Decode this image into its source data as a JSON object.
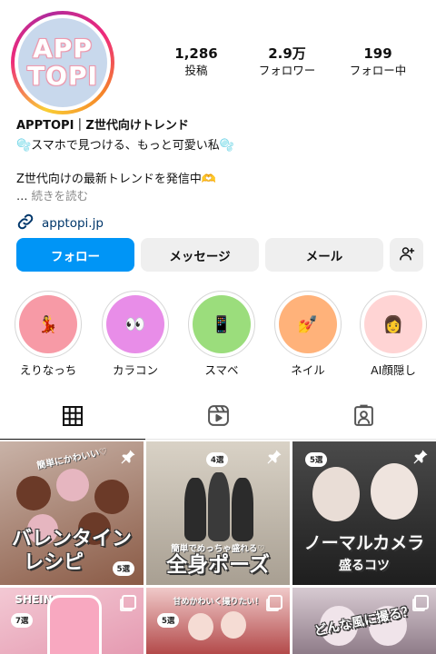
{
  "profile": {
    "avatar_line1": "APP",
    "avatar_line2": "TOPI",
    "name": "APPTOPI｜Z世代向けトレンド",
    "bio_line1": "🫧スマホで見つける、もっと可愛い私🫧",
    "bio_line2": "Z世代向けの最新トレンドを発信中🫶",
    "bio_ellipsis": "…",
    "bio_more": "続きを読む",
    "link": "apptopi.jp"
  },
  "stats": [
    {
      "value": "1,286",
      "label": "投稿"
    },
    {
      "value": "2.9万",
      "label": "フォロワー"
    },
    {
      "value": "199",
      "label": "フォロー中"
    }
  ],
  "buttons": {
    "follow": "フォロー",
    "message": "メッセージ",
    "mail": "メール"
  },
  "highlights": [
    {
      "label": "えりなっち",
      "emoji": "💃",
      "color": "#f79aa6"
    },
    {
      "label": "カラコン",
      "emoji": "👀",
      "color": "#e88de8"
    },
    {
      "label": "スマベ",
      "emoji": "📱",
      "color": "#9bdd7c"
    },
    {
      "label": "ネイル",
      "emoji": "💅",
      "color": "#ffb27a"
    },
    {
      "label": "AI顔隠し",
      "emoji": "👩",
      "color": "#ffd4d4"
    }
  ],
  "posts": [
    {
      "title1": "バレンタイン",
      "title2": "レシピ",
      "top": "簡単にかわいい♡",
      "badge": "5選",
      "colors": [
        "#c9b3a8",
        "#8a5a45"
      ]
    },
    {
      "title1": "全身ポーズ",
      "title2": "",
      "top": "簡単でめっちゃ盛れる♡",
      "badge": "4選",
      "colors": [
        "#d9d2c6",
        "#a89f92"
      ]
    },
    {
      "title1": "ノーマルカメラ",
      "title2": "盛るコツ",
      "top": "",
      "badge": "5選",
      "colors": [
        "#4a4a4a",
        "#1e1e1e"
      ]
    },
    {
      "title1": "",
      "title2": "",
      "top": "SHEIN",
      "badge": "7選",
      "colors": [
        "#f3c9d4",
        "#e59ab1"
      ]
    },
    {
      "title1": "",
      "title2": "",
      "top": "甘めかわいく撮りたい！",
      "badge": "5選",
      "colors": [
        "#f0c9c9",
        "#b34a4a"
      ]
    },
    {
      "title1": "どんな風に撮る？",
      "title2": "",
      "top": "",
      "badge": "",
      "colors": [
        "#d7cad2",
        "#8f7c89"
      ]
    }
  ]
}
